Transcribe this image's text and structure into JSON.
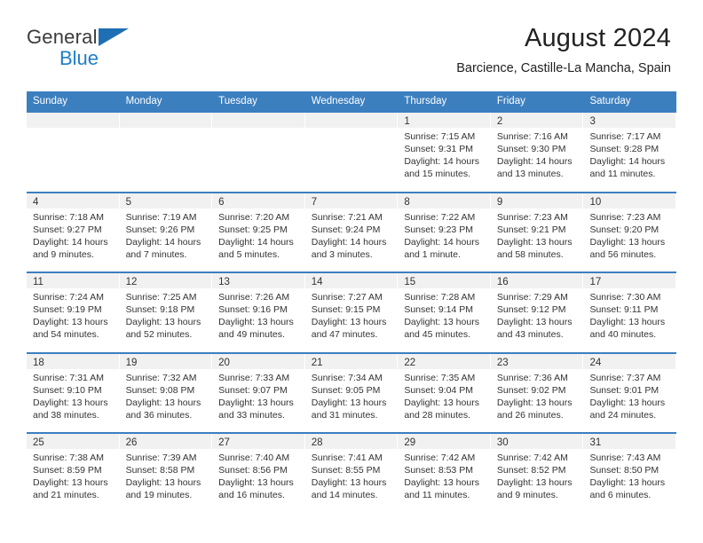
{
  "brand": {
    "name_part1": "General",
    "name_part2": "Blue",
    "flag_icon": "blue-triangle-flag-icon",
    "color_primary": "#1f7ec4",
    "color_text": "#3b3b3b"
  },
  "header": {
    "title": "August 2024",
    "subtitle": "Barcience, Castille-La Mancha, Spain"
  },
  "theme": {
    "header_blue": "#3c7fbf",
    "daynum_band": "#f1f1f1",
    "text": "#333333"
  },
  "calendar": {
    "weekday_headers": [
      "Sunday",
      "Monday",
      "Tuesday",
      "Wednesday",
      "Thursday",
      "Friday",
      "Saturday"
    ],
    "weeks": [
      [
        {
          "day": "",
          "sunrise": "",
          "sunset": "",
          "daylight_line1": "",
          "daylight_line2": ""
        },
        {
          "day": "",
          "sunrise": "",
          "sunset": "",
          "daylight_line1": "",
          "daylight_line2": ""
        },
        {
          "day": "",
          "sunrise": "",
          "sunset": "",
          "daylight_line1": "",
          "daylight_line2": ""
        },
        {
          "day": "",
          "sunrise": "",
          "sunset": "",
          "daylight_line1": "",
          "daylight_line2": ""
        },
        {
          "day": "1",
          "sunrise": "Sunrise: 7:15 AM",
          "sunset": "Sunset: 9:31 PM",
          "daylight_line1": "Daylight: 14 hours",
          "daylight_line2": "and 15 minutes."
        },
        {
          "day": "2",
          "sunrise": "Sunrise: 7:16 AM",
          "sunset": "Sunset: 9:30 PM",
          "daylight_line1": "Daylight: 14 hours",
          "daylight_line2": "and 13 minutes."
        },
        {
          "day": "3",
          "sunrise": "Sunrise: 7:17 AM",
          "sunset": "Sunset: 9:28 PM",
          "daylight_line1": "Daylight: 14 hours",
          "daylight_line2": "and 11 minutes."
        }
      ],
      [
        {
          "day": "4",
          "sunrise": "Sunrise: 7:18 AM",
          "sunset": "Sunset: 9:27 PM",
          "daylight_line1": "Daylight: 14 hours",
          "daylight_line2": "and 9 minutes."
        },
        {
          "day": "5",
          "sunrise": "Sunrise: 7:19 AM",
          "sunset": "Sunset: 9:26 PM",
          "daylight_line1": "Daylight: 14 hours",
          "daylight_line2": "and 7 minutes."
        },
        {
          "day": "6",
          "sunrise": "Sunrise: 7:20 AM",
          "sunset": "Sunset: 9:25 PM",
          "daylight_line1": "Daylight: 14 hours",
          "daylight_line2": "and 5 minutes."
        },
        {
          "day": "7",
          "sunrise": "Sunrise: 7:21 AM",
          "sunset": "Sunset: 9:24 PM",
          "daylight_line1": "Daylight: 14 hours",
          "daylight_line2": "and 3 minutes."
        },
        {
          "day": "8",
          "sunrise": "Sunrise: 7:22 AM",
          "sunset": "Sunset: 9:23 PM",
          "daylight_line1": "Daylight: 14 hours",
          "daylight_line2": "and 1 minute."
        },
        {
          "day": "9",
          "sunrise": "Sunrise: 7:23 AM",
          "sunset": "Sunset: 9:21 PM",
          "daylight_line1": "Daylight: 13 hours",
          "daylight_line2": "and 58 minutes."
        },
        {
          "day": "10",
          "sunrise": "Sunrise: 7:23 AM",
          "sunset": "Sunset: 9:20 PM",
          "daylight_line1": "Daylight: 13 hours",
          "daylight_line2": "and 56 minutes."
        }
      ],
      [
        {
          "day": "11",
          "sunrise": "Sunrise: 7:24 AM",
          "sunset": "Sunset: 9:19 PM",
          "daylight_line1": "Daylight: 13 hours",
          "daylight_line2": "and 54 minutes."
        },
        {
          "day": "12",
          "sunrise": "Sunrise: 7:25 AM",
          "sunset": "Sunset: 9:18 PM",
          "daylight_line1": "Daylight: 13 hours",
          "daylight_line2": "and 52 minutes."
        },
        {
          "day": "13",
          "sunrise": "Sunrise: 7:26 AM",
          "sunset": "Sunset: 9:16 PM",
          "daylight_line1": "Daylight: 13 hours",
          "daylight_line2": "and 49 minutes."
        },
        {
          "day": "14",
          "sunrise": "Sunrise: 7:27 AM",
          "sunset": "Sunset: 9:15 PM",
          "daylight_line1": "Daylight: 13 hours",
          "daylight_line2": "and 47 minutes."
        },
        {
          "day": "15",
          "sunrise": "Sunrise: 7:28 AM",
          "sunset": "Sunset: 9:14 PM",
          "daylight_line1": "Daylight: 13 hours",
          "daylight_line2": "and 45 minutes."
        },
        {
          "day": "16",
          "sunrise": "Sunrise: 7:29 AM",
          "sunset": "Sunset: 9:12 PM",
          "daylight_line1": "Daylight: 13 hours",
          "daylight_line2": "and 43 minutes."
        },
        {
          "day": "17",
          "sunrise": "Sunrise: 7:30 AM",
          "sunset": "Sunset: 9:11 PM",
          "daylight_line1": "Daylight: 13 hours",
          "daylight_line2": "and 40 minutes."
        }
      ],
      [
        {
          "day": "18",
          "sunrise": "Sunrise: 7:31 AM",
          "sunset": "Sunset: 9:10 PM",
          "daylight_line1": "Daylight: 13 hours",
          "daylight_line2": "and 38 minutes."
        },
        {
          "day": "19",
          "sunrise": "Sunrise: 7:32 AM",
          "sunset": "Sunset: 9:08 PM",
          "daylight_line1": "Daylight: 13 hours",
          "daylight_line2": "and 36 minutes."
        },
        {
          "day": "20",
          "sunrise": "Sunrise: 7:33 AM",
          "sunset": "Sunset: 9:07 PM",
          "daylight_line1": "Daylight: 13 hours",
          "daylight_line2": "and 33 minutes."
        },
        {
          "day": "21",
          "sunrise": "Sunrise: 7:34 AM",
          "sunset": "Sunset: 9:05 PM",
          "daylight_line1": "Daylight: 13 hours",
          "daylight_line2": "and 31 minutes."
        },
        {
          "day": "22",
          "sunrise": "Sunrise: 7:35 AM",
          "sunset": "Sunset: 9:04 PM",
          "daylight_line1": "Daylight: 13 hours",
          "daylight_line2": "and 28 minutes."
        },
        {
          "day": "23",
          "sunrise": "Sunrise: 7:36 AM",
          "sunset": "Sunset: 9:02 PM",
          "daylight_line1": "Daylight: 13 hours",
          "daylight_line2": "and 26 minutes."
        },
        {
          "day": "24",
          "sunrise": "Sunrise: 7:37 AM",
          "sunset": "Sunset: 9:01 PM",
          "daylight_line1": "Daylight: 13 hours",
          "daylight_line2": "and 24 minutes."
        }
      ],
      [
        {
          "day": "25",
          "sunrise": "Sunrise: 7:38 AM",
          "sunset": "Sunset: 8:59 PM",
          "daylight_line1": "Daylight: 13 hours",
          "daylight_line2": "and 21 minutes."
        },
        {
          "day": "26",
          "sunrise": "Sunrise: 7:39 AM",
          "sunset": "Sunset: 8:58 PM",
          "daylight_line1": "Daylight: 13 hours",
          "daylight_line2": "and 19 minutes."
        },
        {
          "day": "27",
          "sunrise": "Sunrise: 7:40 AM",
          "sunset": "Sunset: 8:56 PM",
          "daylight_line1": "Daylight: 13 hours",
          "daylight_line2": "and 16 minutes."
        },
        {
          "day": "28",
          "sunrise": "Sunrise: 7:41 AM",
          "sunset": "Sunset: 8:55 PM",
          "daylight_line1": "Daylight: 13 hours",
          "daylight_line2": "and 14 minutes."
        },
        {
          "day": "29",
          "sunrise": "Sunrise: 7:42 AM",
          "sunset": "Sunset: 8:53 PM",
          "daylight_line1": "Daylight: 13 hours",
          "daylight_line2": "and 11 minutes."
        },
        {
          "day": "30",
          "sunrise": "Sunrise: 7:42 AM",
          "sunset": "Sunset: 8:52 PM",
          "daylight_line1": "Daylight: 13 hours",
          "daylight_line2": "and 9 minutes."
        },
        {
          "day": "31",
          "sunrise": "Sunrise: 7:43 AM",
          "sunset": "Sunset: 8:50 PM",
          "daylight_line1": "Daylight: 13 hours",
          "daylight_line2": "and 6 minutes."
        }
      ]
    ]
  }
}
